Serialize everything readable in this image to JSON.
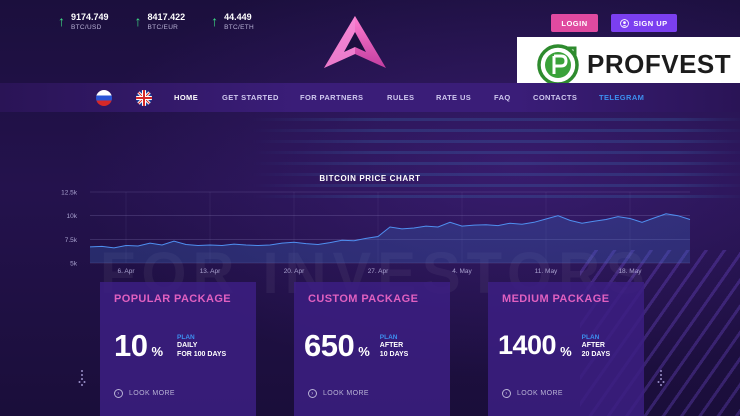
{
  "tickers": [
    {
      "value": "9174.749",
      "pair": "BTC/USD"
    },
    {
      "value": "8417.422",
      "pair": "BTC/EUR"
    },
    {
      "value": "44.449",
      "pair": "BTC/ETH"
    }
  ],
  "header": {
    "login_label": "LOGIN",
    "signup_label": "SIGN UP"
  },
  "brand": {
    "name": "PROFVEST"
  },
  "nav": {
    "items": [
      "HOME",
      "GET STARTED",
      "FOR PARTNERS",
      "RULES",
      "RATE US",
      "FAQ",
      "CONTACTS",
      "TELEGRAM"
    ],
    "active": "HOME"
  },
  "watermark": "FOR INVESTORS",
  "chart_data": {
    "type": "area",
    "title": "BITCOIN PRICE CHART",
    "x_ticks": [
      "6. Apr",
      "13. Apr",
      "20. Apr",
      "27. Apr",
      "4. May",
      "11. May",
      "18. May"
    ],
    "y_ticks": [
      "5k",
      "7.5k",
      "10k",
      "12.5k"
    ],
    "ylim": [
      5000,
      12500
    ],
    "x": [
      "3. Apr",
      "4. Apr",
      "5. Apr",
      "6. Apr",
      "7. Apr",
      "8. Apr",
      "9. Apr",
      "10. Apr",
      "11. Apr",
      "12. Apr",
      "13. Apr",
      "14. Apr",
      "15. Apr",
      "16. Apr",
      "17. Apr",
      "18. Apr",
      "19. Apr",
      "20. Apr",
      "21. Apr",
      "22. Apr",
      "23. Apr",
      "24. Apr",
      "25. Apr",
      "26. Apr",
      "27. Apr",
      "28. Apr",
      "29. Apr",
      "30. Apr",
      "1. May",
      "2. May",
      "3. May",
      "4. May",
      "5. May",
      "6. May",
      "7. May",
      "8. May",
      "9. May",
      "10. May",
      "11. May",
      "12. May",
      "13. May",
      "14. May",
      "15. May",
      "16. May",
      "17. May",
      "18. May",
      "19. May",
      "20. May",
      "21. May",
      "22. May"
    ],
    "values": [
      6700,
      6750,
      6600,
      6850,
      6800,
      7100,
      6900,
      7300,
      6950,
      6850,
      6900,
      6850,
      7000,
      6900,
      6850,
      6900,
      7100,
      7200,
      7050,
      6950,
      7150,
      7400,
      7350,
      7600,
      7800,
      8800,
      8600,
      8700,
      8900,
      8800,
      9300,
      8900,
      9000,
      9050,
      8950,
      9200,
      9100,
      9300,
      9650,
      10000,
      9500,
      9200,
      9400,
      9600,
      9900,
      9700,
      9300,
      9750,
      10200,
      10000,
      9600
    ],
    "grid": true
  },
  "packages": [
    {
      "title": "POPULAR PACKAGE",
      "percent": "10",
      "percent_sign": "%",
      "plan_label": "PLAN",
      "plan_line1": "DAILY",
      "plan_line2": "FOR 100 DAYS",
      "look_more": "LOOK MORE"
    },
    {
      "title": "CUSTOM PACKAGE",
      "percent": "650",
      "percent_sign": "%",
      "plan_label": "PLAN",
      "plan_line1": "AFTER",
      "plan_line2": "10 DAYS",
      "look_more": "LOOK MORE"
    },
    {
      "title": "MEDIUM PACKAGE",
      "percent": "1400",
      "percent_sign": "%",
      "plan_label": "PLAN",
      "plan_line1": "AFTER",
      "plan_line2": "20 DAYS",
      "look_more": "LOOK MORE"
    }
  ],
  "colors": {
    "accent_pink": "#e04aa0",
    "accent_purple": "#7b3ff0",
    "up_green": "#3ddc84",
    "telegram_blue": "#3d8ff0"
  }
}
